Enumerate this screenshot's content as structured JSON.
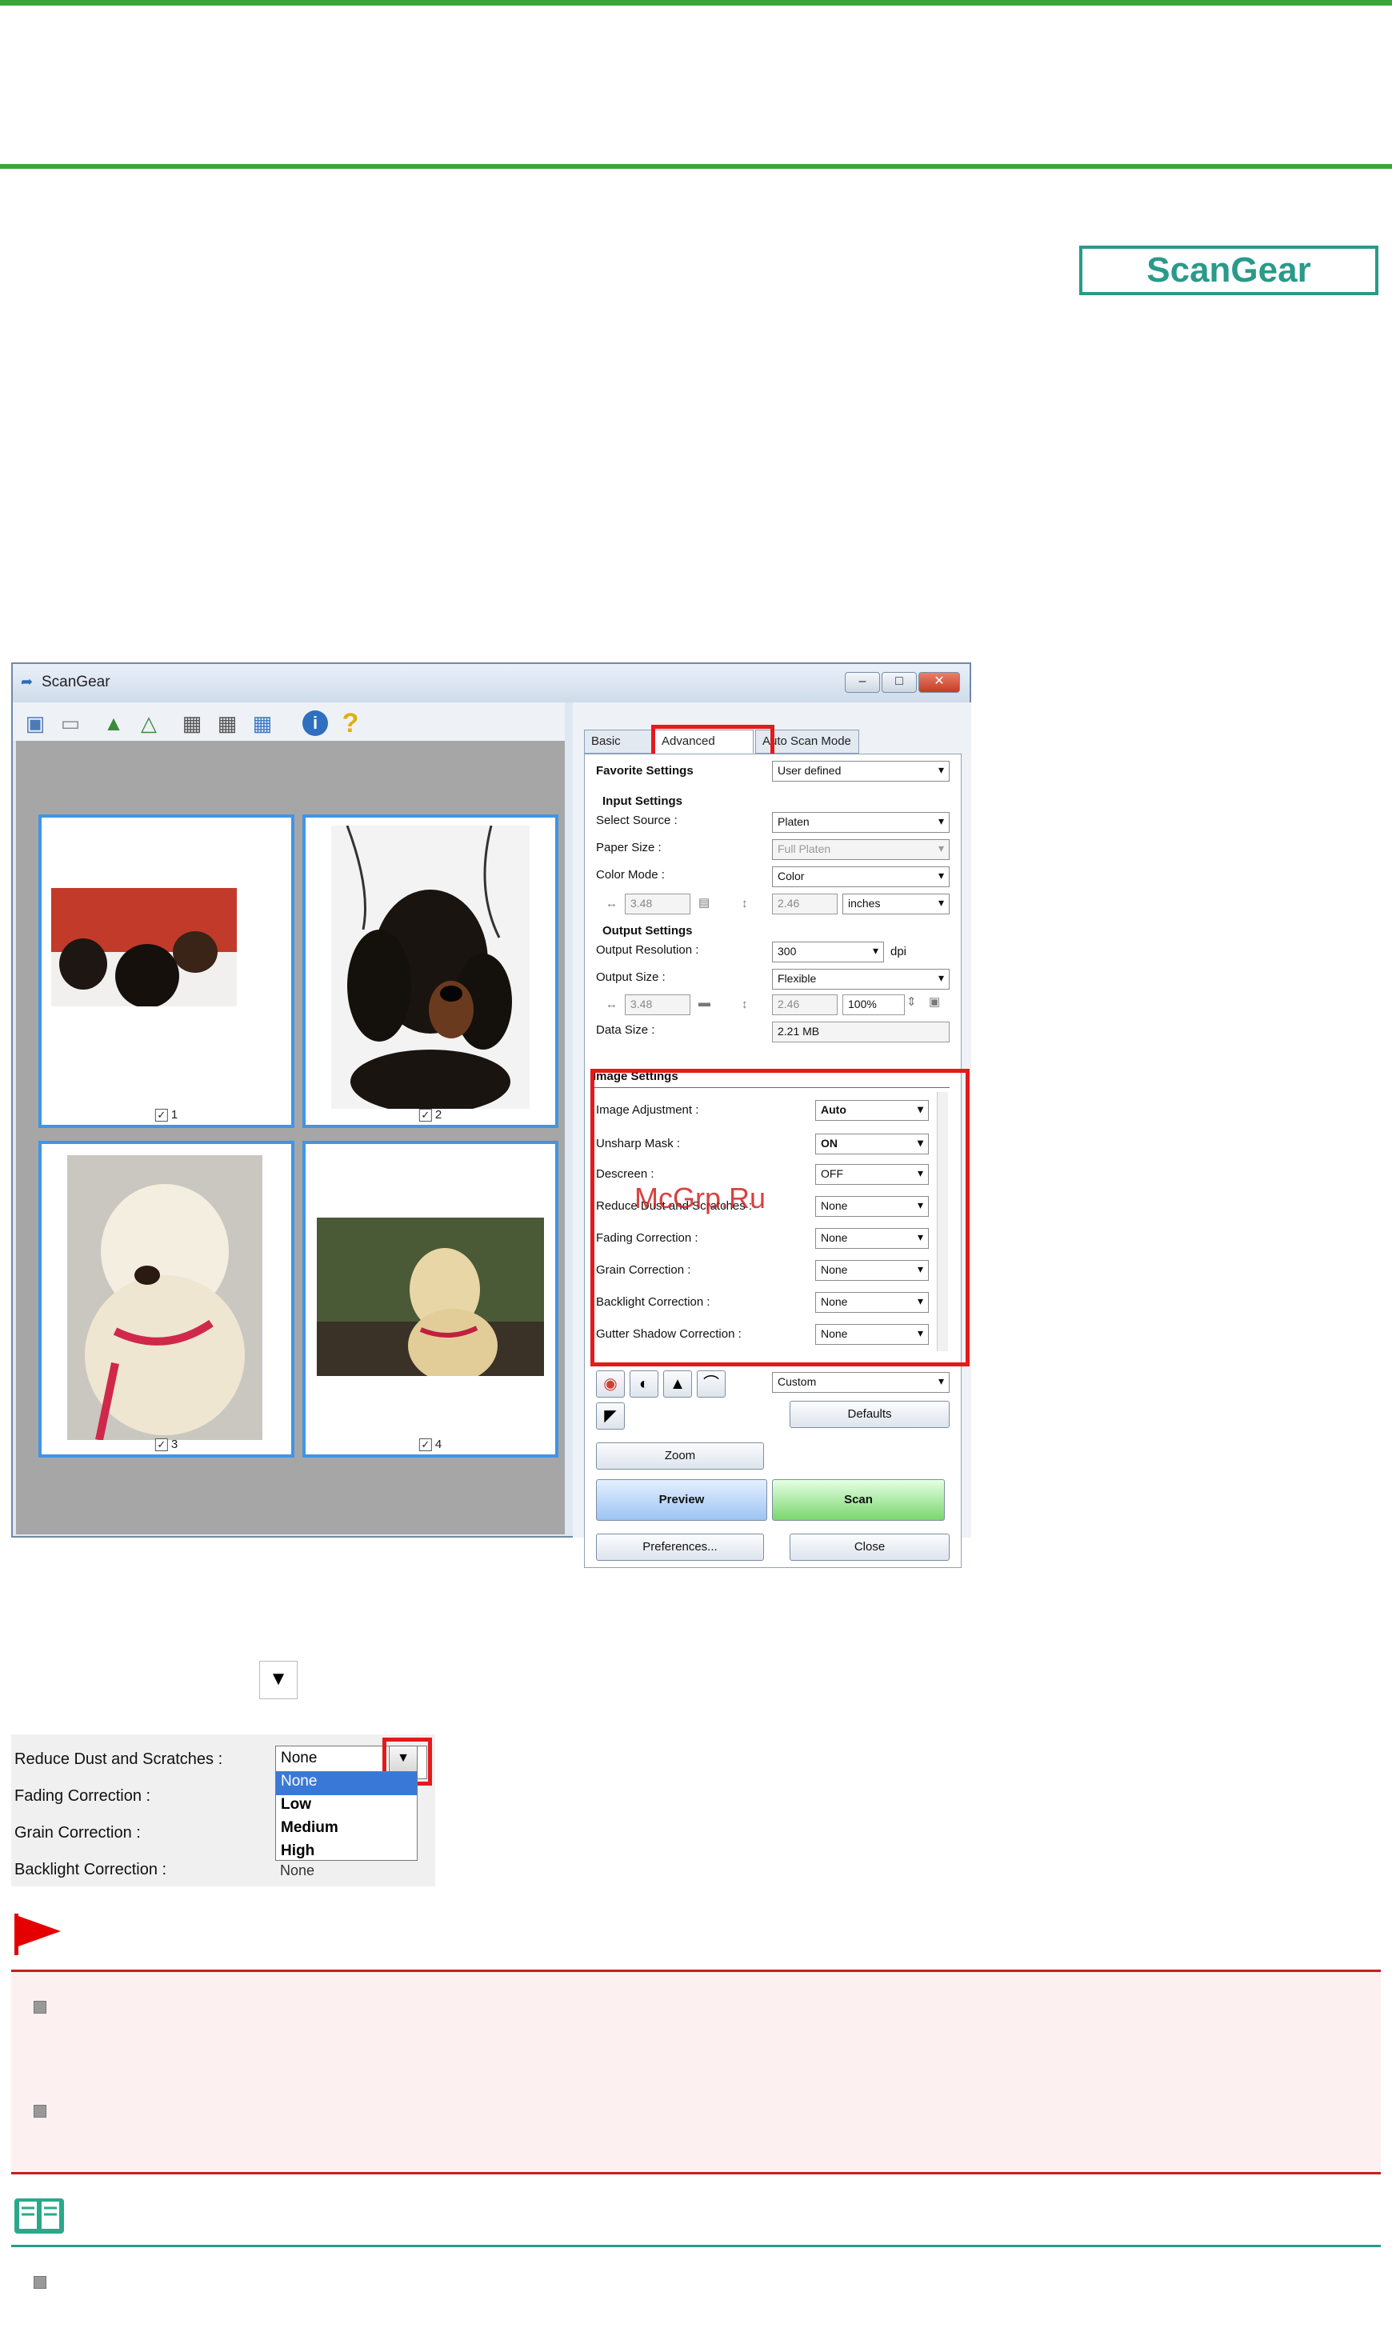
{
  "header": {
    "badge": "ScanGear"
  },
  "window": {
    "title": "ScanGear",
    "thumbnails": [
      {
        "label": "1"
      },
      {
        "label": "2"
      },
      {
        "label": "3"
      },
      {
        "label": "4"
      }
    ],
    "tabs": {
      "basic": "Basic Mode",
      "advanced": "Advanced Mode",
      "auto": "Auto Scan Mode"
    },
    "favorite": {
      "label": "Favorite Settings",
      "value": "User defined"
    },
    "input": {
      "heading": "Input Settings",
      "source_label": "Select Source :",
      "source_value": "Platen",
      "paper_label": "Paper Size :",
      "paper_value": "Full Platen",
      "color_label": "Color Mode :",
      "color_value": "Color",
      "width": "3.48",
      "height": "2.46",
      "unit": "inches"
    },
    "output": {
      "heading": "Output Settings",
      "res_label": "Output Resolution :",
      "res_value": "300",
      "res_unit": "dpi",
      "size_label": "Output Size :",
      "size_value": "Flexible",
      "width": "3.48",
      "height": "2.46",
      "scale": "100%",
      "data_label": "Data Size :",
      "data_value": "2.21 MB"
    },
    "image": {
      "heading": "Image Settings",
      "rows": [
        {
          "label": "Image Adjustment :",
          "value": "Auto"
        },
        {
          "label": "Unsharp Mask :",
          "value": "ON"
        },
        {
          "label": "Descreen :",
          "value": "OFF"
        },
        {
          "label": "Reduce Dust and Scratches :",
          "value": "None"
        },
        {
          "label": "Fading Correction :",
          "value": "None"
        },
        {
          "label": "Grain Correction :",
          "value": "None"
        },
        {
          "label": "Backlight Correction :",
          "value": "None"
        },
        {
          "label": "Gutter Shadow Correction :",
          "value": "None"
        }
      ]
    },
    "custom_value": "Custom",
    "buttons": {
      "defaults": "Defaults",
      "zoom": "Zoom",
      "preview": "Preview",
      "scan": "Scan",
      "preferences": "Preferences...",
      "close": "Close"
    },
    "watermark": "McGrp.Ru"
  },
  "crop": {
    "rows": [
      "Reduce Dust and Scratches :",
      "Fading Correction :",
      "Grain Correction :",
      "Backlight Correction :"
    ],
    "selected": "None",
    "options": [
      "None",
      "Low",
      "Medium",
      "High"
    ],
    "last_value": "None"
  }
}
